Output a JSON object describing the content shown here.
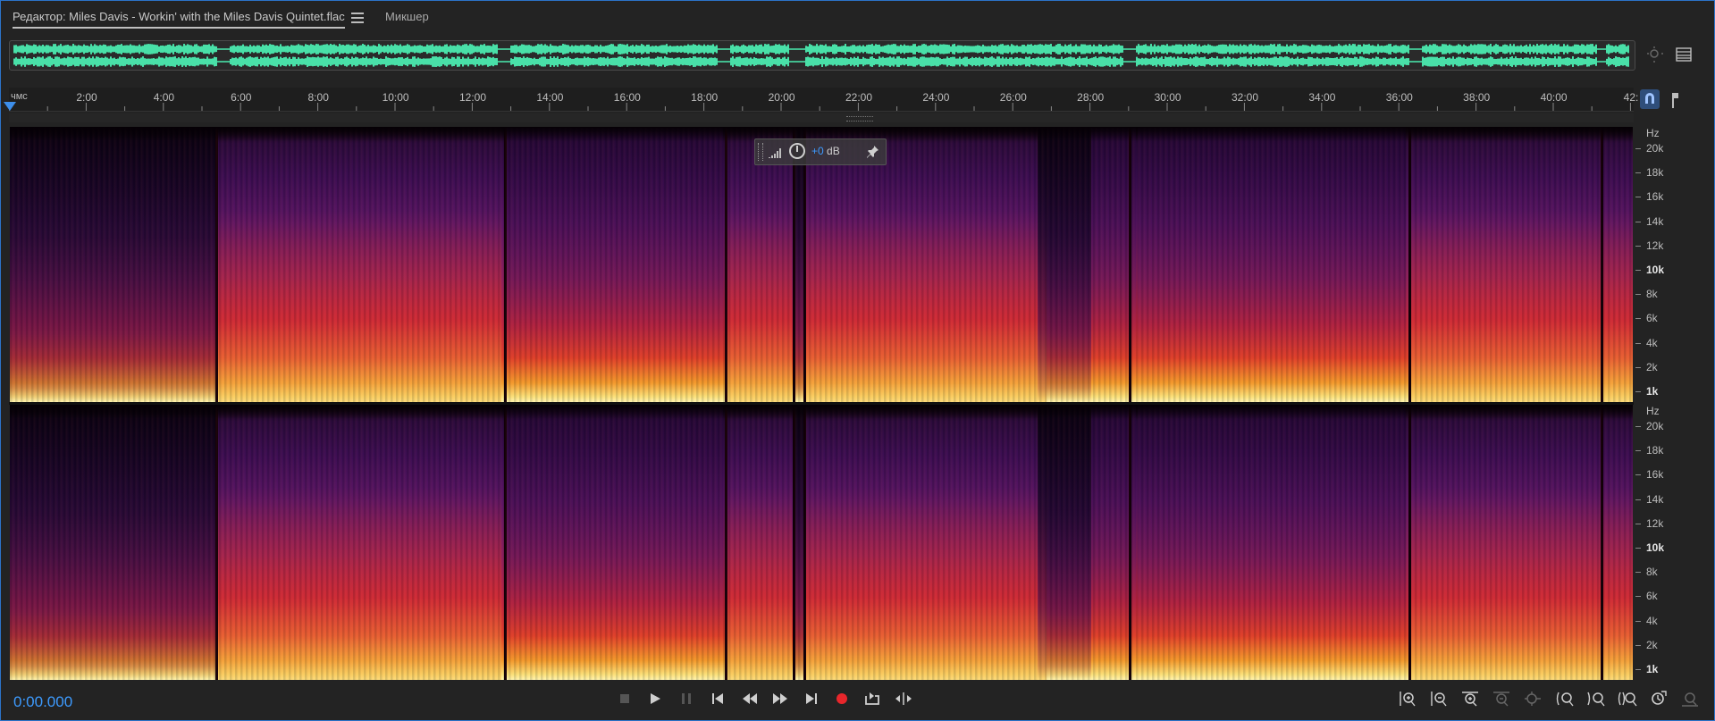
{
  "tabs": {
    "editor_label": "Редактор: Miles Davis - Workin' with the Miles Davis Quintet.flac",
    "mixer_label": "Микшер"
  },
  "ruler": {
    "unit": "чмс",
    "ticks": [
      "2:00",
      "4:00",
      "6:00",
      "8:00",
      "10:00",
      "12:00",
      "14:00",
      "16:00",
      "18:00",
      "20:00",
      "22:00",
      "24:00",
      "26:00",
      "28:00",
      "30:00",
      "32:00",
      "34:00",
      "36:00",
      "38:00",
      "40:00",
      "42:"
    ]
  },
  "hz_scale": {
    "unit": "Hz",
    "unit_ch2": "Hz",
    "labels_ch1": [
      "20k",
      "18k",
      "16k",
      "14k",
      "12k",
      "10k",
      "8k",
      "6k",
      "4k",
      "2k",
      "1k"
    ],
    "labels_ch2": [
      "20k",
      "18k",
      "16k",
      "14k",
      "12k",
      "10k",
      "8k",
      "6k",
      "4k",
      "2k",
      "1k"
    ]
  },
  "hud": {
    "db_value": "+0",
    "db_unit": " dB"
  },
  "status": {
    "timecode": "0:00.000"
  },
  "colors": {
    "accent": "#3d9bff",
    "waveform": "#49e0a8",
    "record": "#e8262b"
  },
  "icons": {
    "transport": [
      "stop-icon",
      "play-icon",
      "pause-icon",
      "skip-start-icon",
      "rewind-icon",
      "fast-forward-icon",
      "skip-end-icon",
      "record-icon",
      "loop-icon",
      "skip-selection-icon"
    ],
    "zoom": [
      "zoom-in-amplitude-icon",
      "zoom-out-amplitude-icon",
      "zoom-in-time-icon",
      "zoom-out-time-icon",
      "zoom-full-icon",
      "zoom-in-selection-icon",
      "zoom-out-left-icon",
      "zoom-out-right-icon",
      "zoom-to-selection-icon",
      "zoom-reset-icon"
    ]
  }
}
